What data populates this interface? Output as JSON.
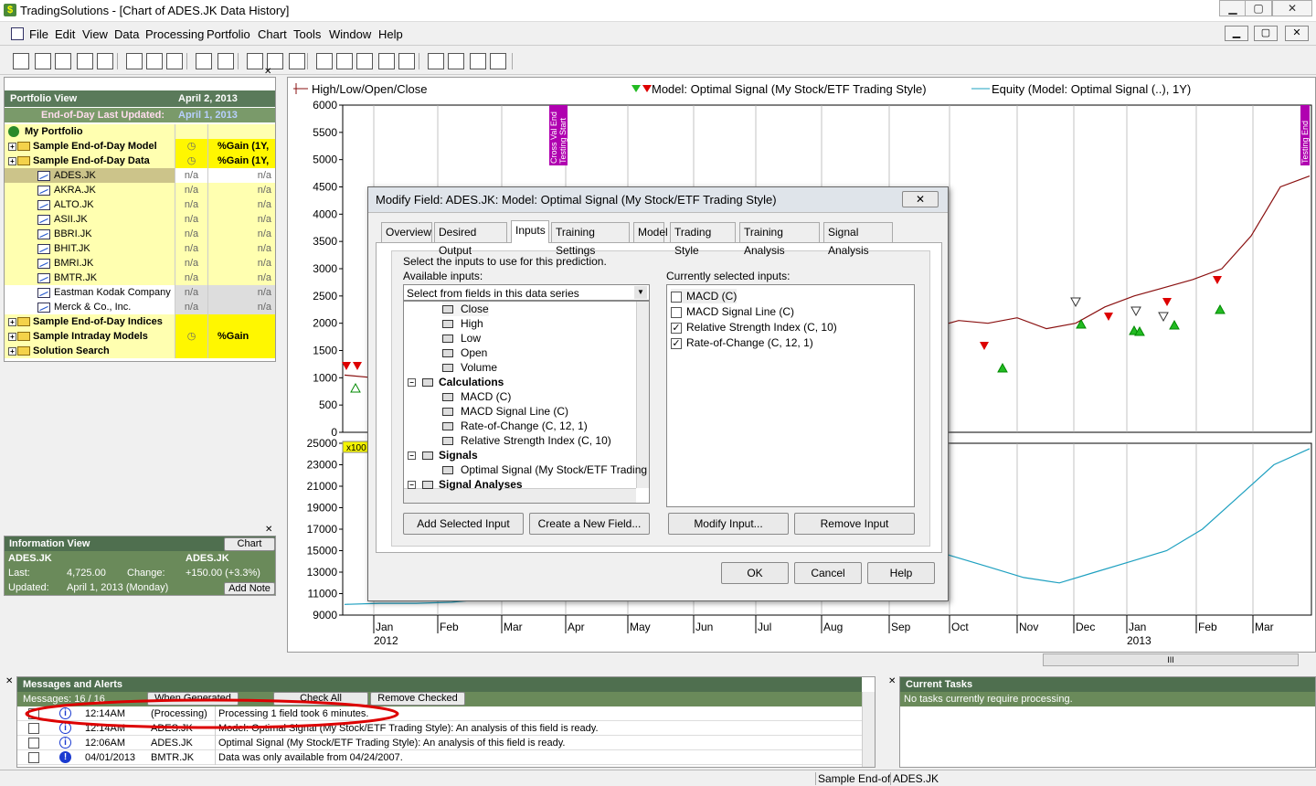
{
  "window": {
    "title": "TradingSolutions - [Chart of ADES.JK Data History]",
    "min": "▁",
    "max": "▢",
    "close": "✕"
  },
  "menu": [
    "File",
    "Edit",
    "View",
    "Data",
    "Processing",
    "Portfolio",
    "Chart",
    "Tools",
    "Window",
    "Help"
  ],
  "toolbar_icons": [
    "new-icon",
    "open-icon",
    "open2-icon",
    "delete-icon",
    "save-icon",
    "paste-icon",
    "import-icon",
    "export-icon",
    "chart-icon",
    "report-icon",
    "cut-icon",
    "copy-icon",
    "paste2-icon",
    "function-icon",
    "arrows-icon",
    "stop-icon",
    "run-icon",
    "optimize-icon",
    "book-icon",
    "alarm-icon",
    "tools-icon",
    "help-icon"
  ],
  "portfolio": {
    "title": "Portfolio View",
    "date": "April 2, 2013",
    "updated_label": "End-of-Day Last Updated:",
    "updated_date": "April 1, 2013",
    "root": "My Portfolio",
    "groups": [
      {
        "name": "Sample End-of-Day Model",
        "col2": "%Gain (1Y,"
      },
      {
        "name": "Sample End-of-Day Data",
        "col2": "%Gain (1Y,"
      }
    ],
    "items": [
      {
        "name": "ADES.JK",
        "c1": "n/a",
        "c2": "n/a"
      },
      {
        "name": "AKRA.JK",
        "c1": "n/a",
        "c2": "n/a"
      },
      {
        "name": "ALTO.JK",
        "c1": "n/a",
        "c2": "n/a"
      },
      {
        "name": "ASII.JK",
        "c1": "n/a",
        "c2": "n/a"
      },
      {
        "name": "BBRI.JK",
        "c1": "n/a",
        "c2": "n/a"
      },
      {
        "name": "BHIT.JK",
        "c1": "n/a",
        "c2": "n/a"
      },
      {
        "name": "BMRI.JK",
        "c1": "n/a",
        "c2": "n/a"
      },
      {
        "name": "BMTR.JK",
        "c1": "n/a",
        "c2": "n/a"
      },
      {
        "name": "Eastman Kodak Company",
        "c1": "n/a",
        "c2": "n/a"
      },
      {
        "name": "Merck & Co., Inc.",
        "c1": "n/a",
        "c2": "n/a"
      }
    ],
    "groups2": [
      {
        "name": "Sample End-of-Day Indices",
        "col2": ""
      },
      {
        "name": "Sample Intraday Models",
        "col2": "%Gain (w/C"
      },
      {
        "name": "Solution Search",
        "col2": ""
      }
    ]
  },
  "info": {
    "title": "Information View",
    "chart_btn": "Chart",
    "symbol": "ADES.JK",
    "symbol2": "ADES.JK",
    "last_label": "Last:",
    "last_value": "4,725.00",
    "change_label": "Change:",
    "change_value": "+150.00  (+3.3%)",
    "updated_label": "Updated:",
    "updated_value": "April 1, 2013 (Monday)",
    "add_note": "Add Note"
  },
  "chart": {
    "legend1": "High/Low/Open/Close",
    "legend2": "Model: Optimal Signal (My Stock/ETF Trading Style)",
    "legend3": "Equity (Model: Optimal Signal (..), 1Y)",
    "marker1": "Cross Val End",
    "marker2": "Testing Start",
    "marker3": "Testing End",
    "scale_badge": "x100",
    "x_labels": [
      "Jan",
      "Feb",
      "Mar",
      "Apr",
      "May",
      "Jun",
      "Jul",
      "Aug",
      "Sep",
      "Oct",
      "Nov",
      "Dec",
      "Jan",
      "Feb",
      "Mar"
    ],
    "year1": "2012",
    "year2": "2013",
    "scroll_grip": "III"
  },
  "chart_data": [
    {
      "type": "line",
      "title": "",
      "series": [
        {
          "name": "High/Low/Open/Close",
          "values": [
            1050,
            1000,
            980,
            1050,
            1100,
            1150,
            1200,
            1180,
            1250,
            1300,
            1380,
            1350,
            1420,
            1500,
            1600,
            1900,
            2450,
            2300,
            2200,
            2100,
            1900,
            2050,
            2000,
            2100,
            1900,
            2000,
            2300,
            2500,
            2650,
            2800,
            3000,
            3600,
            4500,
            4700
          ]
        },
        {
          "name": "Model: Optimal Signal (My Stock/ETF Trading Style)",
          "values": []
        }
      ],
      "ylim": [
        0,
        6000
      ],
      "yticks": [
        0,
        500,
        1000,
        1500,
        2000,
        2500,
        3000,
        3500,
        4000,
        4500,
        5000,
        5500,
        6000
      ]
    },
    {
      "type": "line",
      "series": [
        {
          "name": "Equity (Model: Optimal Signal (..), 1Y)",
          "values": [
            10000,
            10100,
            10100,
            10200,
            10500,
            11000,
            12000,
            13000,
            11500,
            12000,
            14000,
            18500,
            20000,
            17500,
            18000,
            16000,
            15500,
            14500,
            13500,
            12500,
            12000,
            13000,
            14000,
            15000,
            17000,
            20000,
            23000,
            24500
          ]
        }
      ],
      "ylim": [
        9000,
        25000
      ],
      "yticks": [
        9000,
        11000,
        13000,
        15000,
        17000,
        19000,
        21000,
        23000,
        25000
      ]
    }
  ],
  "dialog": {
    "title": "Modify Field: ADES.JK: Model: Optimal Signal (My Stock/ETF Trading Style)",
    "tabs": [
      "Overview",
      "Desired Output",
      "Inputs",
      "Training Settings",
      "Model",
      "Trading Style",
      "Training Analysis",
      "Signal Analysis"
    ],
    "instruction": "Select the inputs to use for this prediction.",
    "available_label": "Available inputs:",
    "selected_label": "Currently selected inputs:",
    "combo_value": "Select from fields in this data series",
    "tree": [
      {
        "label": "Close",
        "level": 2
      },
      {
        "label": "High",
        "level": 2
      },
      {
        "label": "Low",
        "level": 2
      },
      {
        "label": "Open",
        "level": 2
      },
      {
        "label": "Volume",
        "level": 2
      },
      {
        "label": "Calculations",
        "level": 1
      },
      {
        "label": "MACD (C)",
        "level": 2
      },
      {
        "label": "MACD Signal Line (C)",
        "level": 2
      },
      {
        "label": "Rate-of-Change (C, 12, 1)",
        "level": 2
      },
      {
        "label": "Relative Strength Index (C, 10)",
        "level": 2
      },
      {
        "label": "Signals",
        "level": 1
      },
      {
        "label": "Optimal Signal (My Stock/ETF Trading S",
        "level": 2
      },
      {
        "label": "Signal Analyses",
        "level": 1
      }
    ],
    "selected": [
      {
        "label": "MACD (C)",
        "checked": false
      },
      {
        "label": "MACD Signal Line (C)",
        "checked": false
      },
      {
        "label": "Relative Strength Index (C, 10)",
        "checked": true
      },
      {
        "label": "Rate-of-Change (C, 12, 1)",
        "checked": true
      }
    ],
    "add_selected": "Add Selected Input",
    "create_field": "Create a New Field...",
    "modify_input": "Modify Input...",
    "remove_input": "Remove Input",
    "ok": "OK",
    "cancel": "Cancel",
    "help": "Help",
    "close": "✕"
  },
  "messages": {
    "title": "Messages and Alerts",
    "subheader": "Messages: 16 / 16",
    "btn1": "When Generated",
    "btn2": "Check All",
    "btn3": "Remove Checked",
    "rows": [
      {
        "time": "12:14AM",
        "source": "(Processing)",
        "text": "Processing 1 field took 6 minutes."
      },
      {
        "time": "12:14AM",
        "source": "ADES.JK",
        "text": "Model: Optimal Signal (My Stock/ETF Trading Style): An analysis of this field is ready."
      },
      {
        "time": "12:06AM",
        "source": "ADES.JK",
        "text": "Optimal Signal (My Stock/ETF Trading Style): An analysis of this field is ready."
      },
      {
        "time": "04/01/2013",
        "source": "BMTR.JK",
        "text": "Data was only available from 04/24/2007."
      }
    ]
  },
  "tasks": {
    "title": "Current Tasks",
    "text": "No tasks currently require processing."
  },
  "status": {
    "left": "Sample End-of",
    "right": "ADES.JK"
  },
  "colors": {
    "panel_header": "#5a7a5a",
    "equity_line": "#1ea0c0",
    "price_line": "#8a1010",
    "down_signal": "#dd0000",
    "up_signal": "#22bb22",
    "marker": "#b000b0",
    "annotation": "#dd0000"
  }
}
